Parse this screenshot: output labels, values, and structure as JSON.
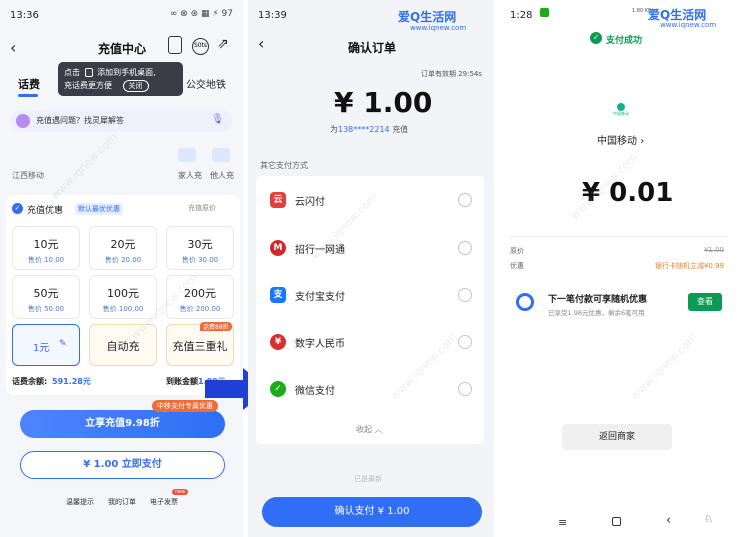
{
  "watermark": {
    "brand": "爱Q生活网",
    "url": "www.iqnew.com"
  },
  "panel1": {
    "time": "13:36",
    "status_icons": "∞ ⊗ ⊛ ▦ ⚡ 97",
    "title": "充值中心",
    "tooltip_line1": "点击",
    "tooltip_line1b": "添加到手机桌面,",
    "tooltip_line2": "充话费更方便",
    "tooltip_close": "关闭",
    "tab_active": "话费",
    "tab_partial": "话",
    "tab_bus": "公交地铁",
    "assistant_text": "充值遇问题？找灵犀解答",
    "carrier": "江西移动",
    "family_label": "家人充",
    "others_label": "他人充",
    "promo_title": "充值优惠",
    "promo_badge": "默认最优优惠",
    "promo_right": "充值原价",
    "amounts": [
      {
        "big": "10元",
        "small": "售价 10.00"
      },
      {
        "big": "20元",
        "small": "售价 20.00"
      },
      {
        "big": "30元",
        "small": "售价 30.00"
      },
      {
        "big": "50元",
        "small": "售价 50.00"
      },
      {
        "big": "100元",
        "small": "售价 100.00"
      },
      {
        "big": "200元",
        "small": "售价 200.00"
      }
    ],
    "custom_amount": "1元",
    "auto_recharge": "自动充",
    "triple_gift": "充值三重礼",
    "triple_badge": "话费88折",
    "balance_label": "话费余额:",
    "balance_value": "591.28元",
    "arrival_label": "到账金额",
    "arrival_value": "1.00元",
    "promo_tag": "中移支付专属优惠",
    "btn_recharge": "立享充值9.98折",
    "btn_pay": "¥ 1.00 立即支付",
    "footer_tip": "温馨提示",
    "footer_orders": "我的订单",
    "footer_invoice": "电子发票",
    "footer_new": "new"
  },
  "panel2": {
    "time": "13:39",
    "title": "确认订单",
    "expire": "订单有效期 29:54s",
    "amount": "¥ 1.00",
    "phone_prefix": "为",
    "phone": "138****2214",
    "phone_suffix": "充值",
    "other_methods": "其它支付方式",
    "methods": [
      {
        "label": "云闪付",
        "color": "#e43f3a",
        "icon": "unionpay-icon",
        "glyph": "云"
      },
      {
        "label": "招行一网通",
        "color": "#d3272b",
        "icon": "cmb-icon",
        "glyph": "M"
      },
      {
        "label": "支付宝支付",
        "color": "#1677ff",
        "icon": "alipay-icon",
        "glyph": "支"
      },
      {
        "label": "数字人民币",
        "color": "#d92f2f",
        "icon": "ecny-icon",
        "glyph": "¥"
      },
      {
        "label": "微信支付",
        "color": "#1aad19",
        "icon": "wechat-icon",
        "glyph": "✓"
      }
    ],
    "collapse": "收起",
    "bottom_hint": "已是最新",
    "confirm_btn": "确认支付 ¥ 1.00"
  },
  "panel3": {
    "time": "1:28",
    "signal": "1.80 KB/s",
    "pay_success": "支付成功",
    "merchant_logo": "中国移动",
    "merchant": "中国移动",
    "amount": "¥ 0.01",
    "original_label": "原价",
    "original_value": "¥1.00",
    "discount_label": "优惠",
    "discount_value": "银行卡随机立减¥0.99",
    "next_title": "下一笔付款可享随机优惠",
    "next_desc": "已享受1.98元优惠，剩余6笔可用",
    "view_btn": "查看",
    "back_btn": "返回商家"
  },
  "colors": {
    "blue": "#2f6ef5",
    "green": "#1aad19",
    "wechat_title": "#0a9b52",
    "arrow": "#1f3fd6",
    "orange": "#ff7a2e"
  }
}
